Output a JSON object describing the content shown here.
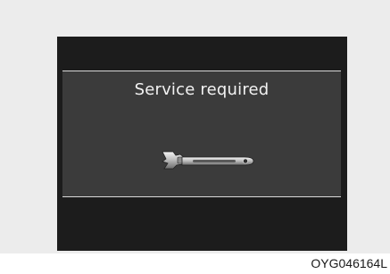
{
  "display": {
    "message": "Service required",
    "icon": "wrench-icon"
  },
  "caption": "OYG046164L",
  "colors": {
    "screen_background": "#1c1c1c",
    "panel_background": "#3b3b3b",
    "divider_lines": "#d9d9d9",
    "text": "#f2f2f2"
  }
}
